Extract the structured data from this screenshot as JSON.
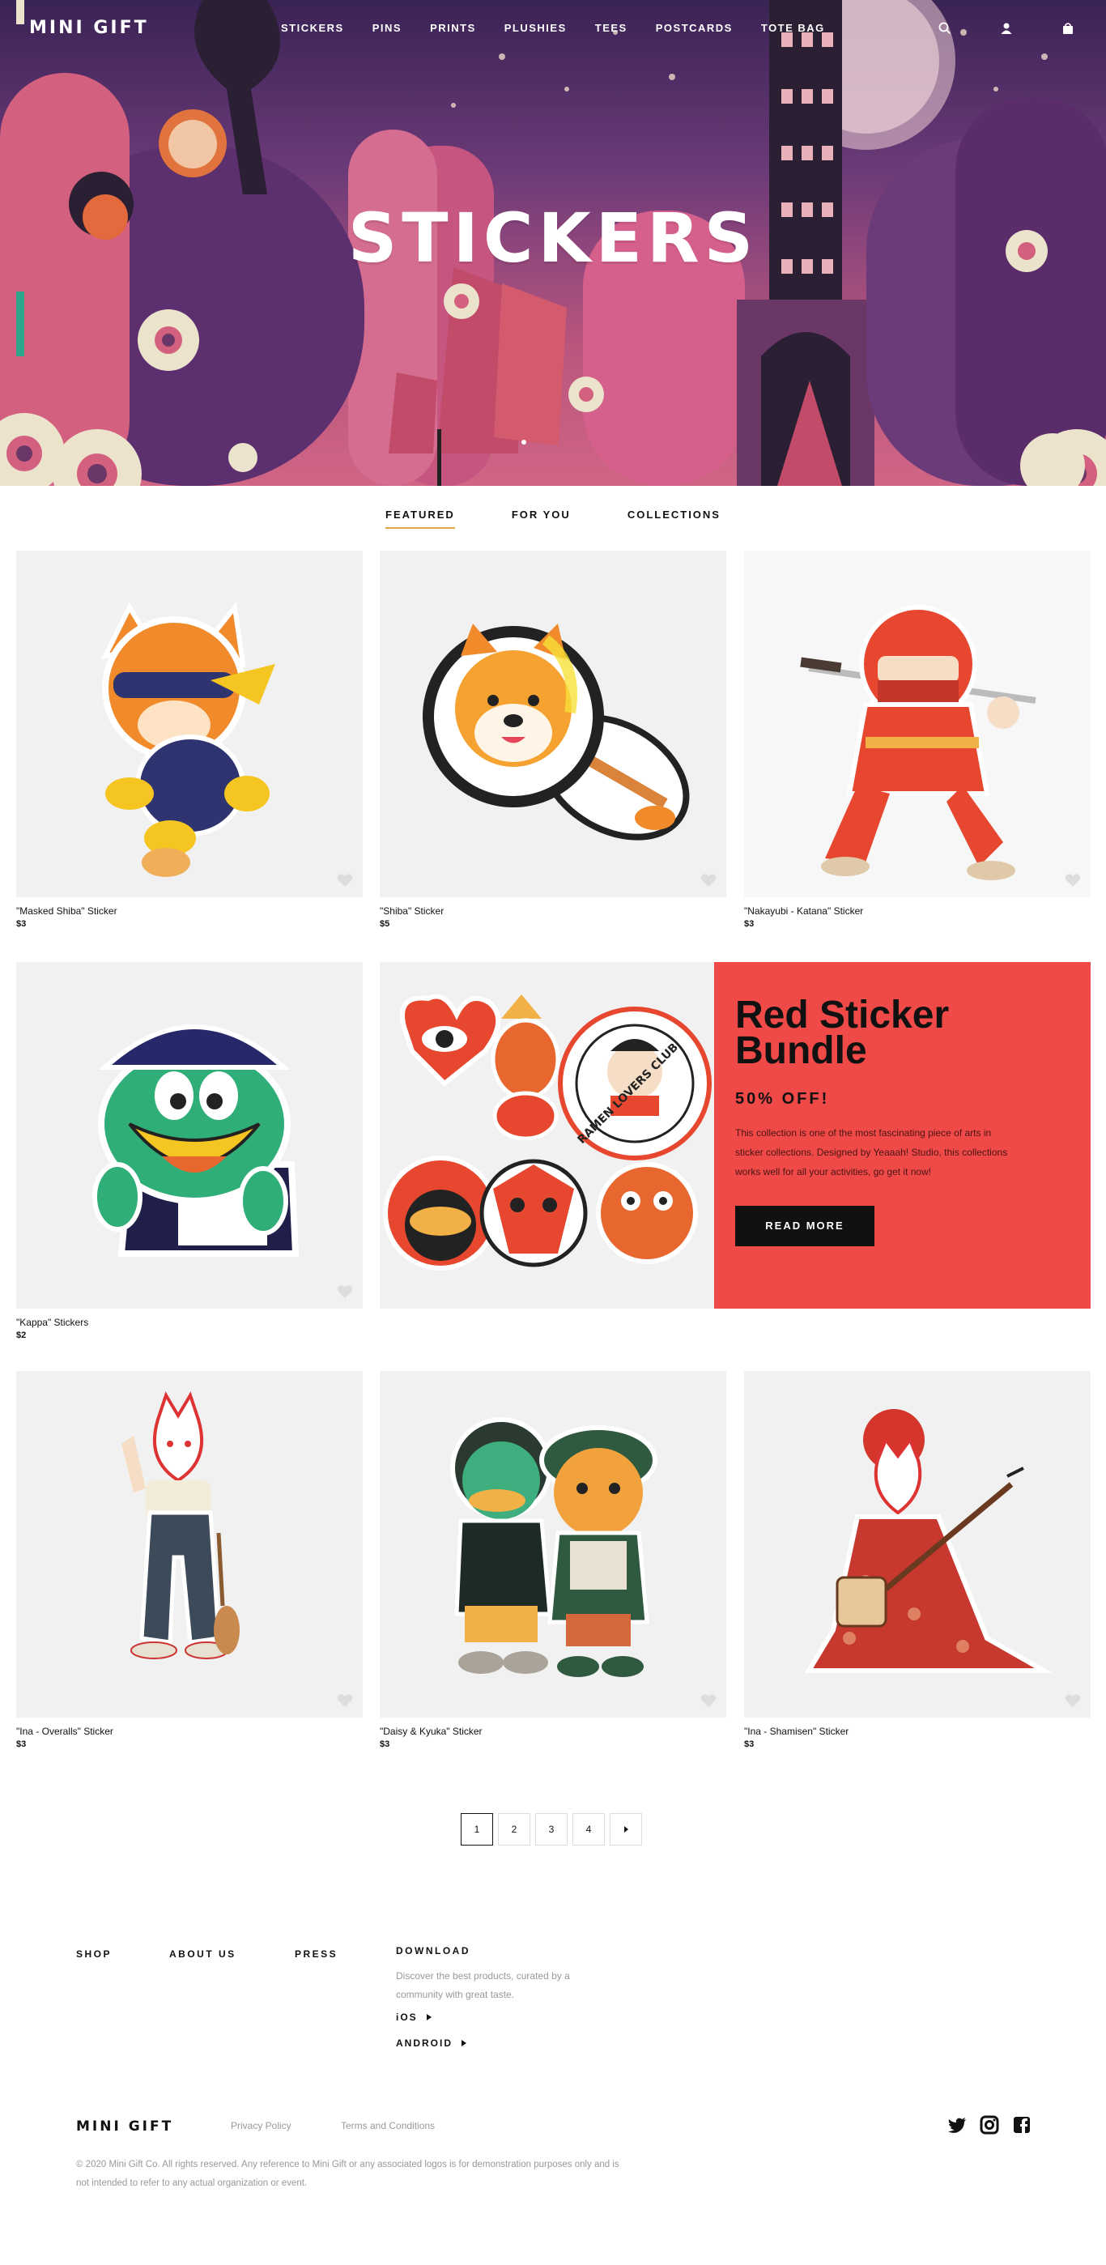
{
  "brand": {
    "logo": "MINI GIFT"
  },
  "nav": {
    "links": [
      "STICKERS",
      "PINS",
      "PRINTS",
      "PLUSHIES",
      "TEES",
      "POSTCARDS",
      "TOTE BAG"
    ],
    "icons": [
      "search-icon",
      "user-icon",
      "bag-icon"
    ]
  },
  "hero": {
    "title": "STICKERS",
    "slide_count": 1,
    "active_slide": 1
  },
  "tabs": {
    "items": [
      "FEATURED",
      "FOR YOU",
      "COLLECTIONS"
    ],
    "active": "FEATURED"
  },
  "products": [
    {
      "name": "\"Masked Shiba\" Sticker",
      "price": "$3"
    },
    {
      "name": "\"Shiba\" Sticker",
      "price": "$5"
    },
    {
      "name": "\"Nakayubi - Katana\" Sticker",
      "price": "$3"
    },
    {
      "name": "\"Kappa\" Stickers",
      "price": "$2"
    },
    {
      "name": "\"Ina - Overalls\" Sticker",
      "price": "$3"
    },
    {
      "name": "\"Daisy & Kyuka\" Sticker",
      "price": "$3"
    },
    {
      "name": "\"Ina - Shamisen\" Sticker",
      "price": "$3"
    }
  ],
  "promo": {
    "title_line1": "Red Sticker",
    "title_line2": "Bundle",
    "discount": "50% OFF!",
    "description": "This collection is one of the most fascinating piece of arts in sticker collections. Designed by Yeaaah! Studio, this collections works well for all your activities, go get it now!",
    "button": "READ MORE",
    "badge_text": "RAMEN LOVERS CLUB",
    "color": "#f04a48"
  },
  "pagination": {
    "pages": [
      "1",
      "2",
      "3",
      "4"
    ],
    "current": "1",
    "next_icon": "chevron-right-icon"
  },
  "footer": {
    "columns": [
      "SHOP",
      "ABOUT US",
      "PRESS",
      "DOWNLOAD"
    ],
    "download_text": "Discover the best products, curated by a community with great taste.",
    "ios": "iOS",
    "android": "ANDROID",
    "logo": "MINI GIFT",
    "privacy": "Privacy Policy",
    "terms": "Terms and Conditions",
    "social": [
      "twitter-icon",
      "instagram-icon",
      "facebook-icon"
    ],
    "copyright": "© 2020 Mini Gift Co. All rights reserved. Any reference to Mini Gift or any associated logos is for demonstration purposes only and is not intended to refer to any actual organization or event."
  }
}
